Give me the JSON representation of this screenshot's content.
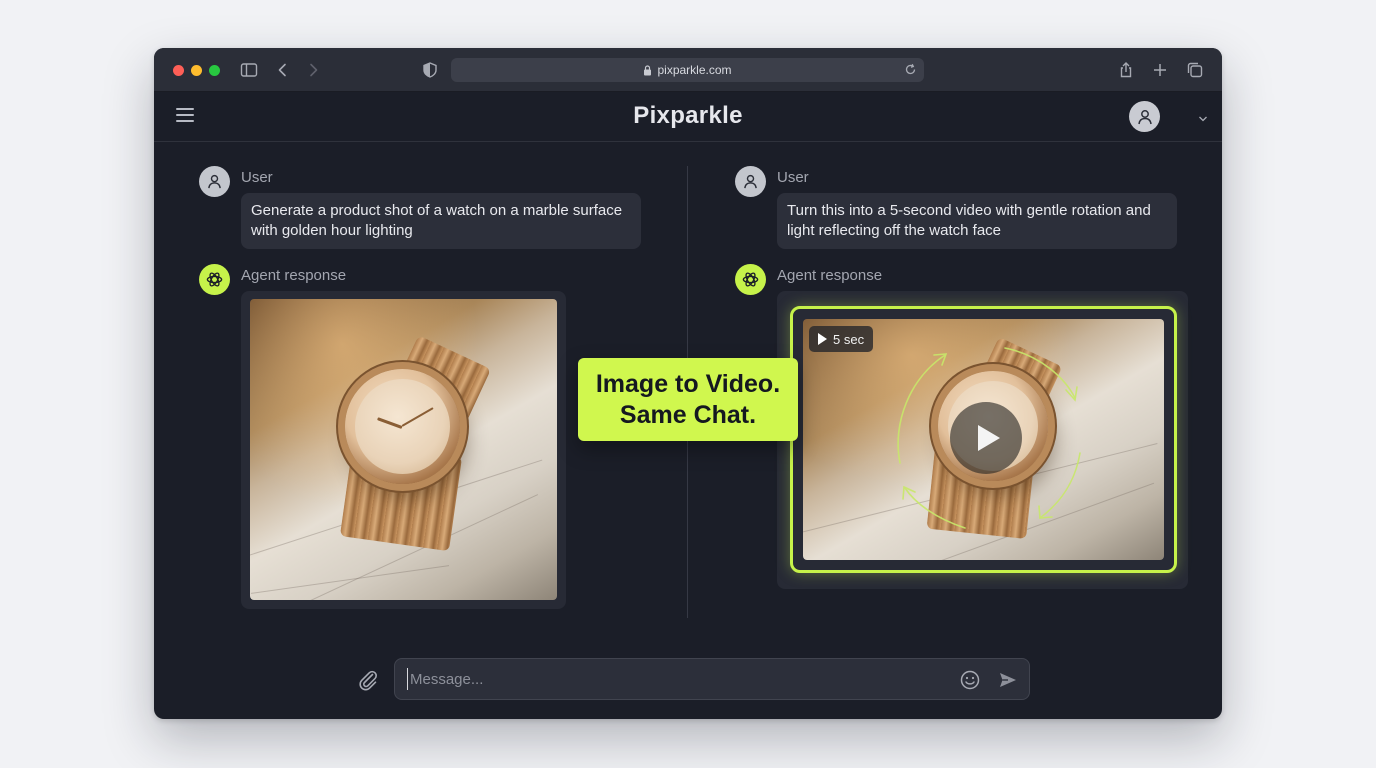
{
  "browser": {
    "url": "pixparkle.com"
  },
  "app": {
    "title": "Pixparkle"
  },
  "left_chat": {
    "user_label": "User",
    "user_message": "Generate a product shot of a watch on a marble surface with golden hour lighting",
    "agent_label": "Agent response"
  },
  "right_chat": {
    "user_label": "User",
    "user_message": "Turn this into a 5-second video with gentle rotation and light reflecting off the watch face",
    "agent_label": "Agent response",
    "video_duration": "5 sec"
  },
  "callout": {
    "line1": "Image to Video.",
    "line2": "Same Chat."
  },
  "composer": {
    "placeholder": "Message..."
  },
  "colors": {
    "accent": "#c6f24a",
    "window_bg": "#1b1e28",
    "bubble_bg": "#2c2f3a"
  }
}
